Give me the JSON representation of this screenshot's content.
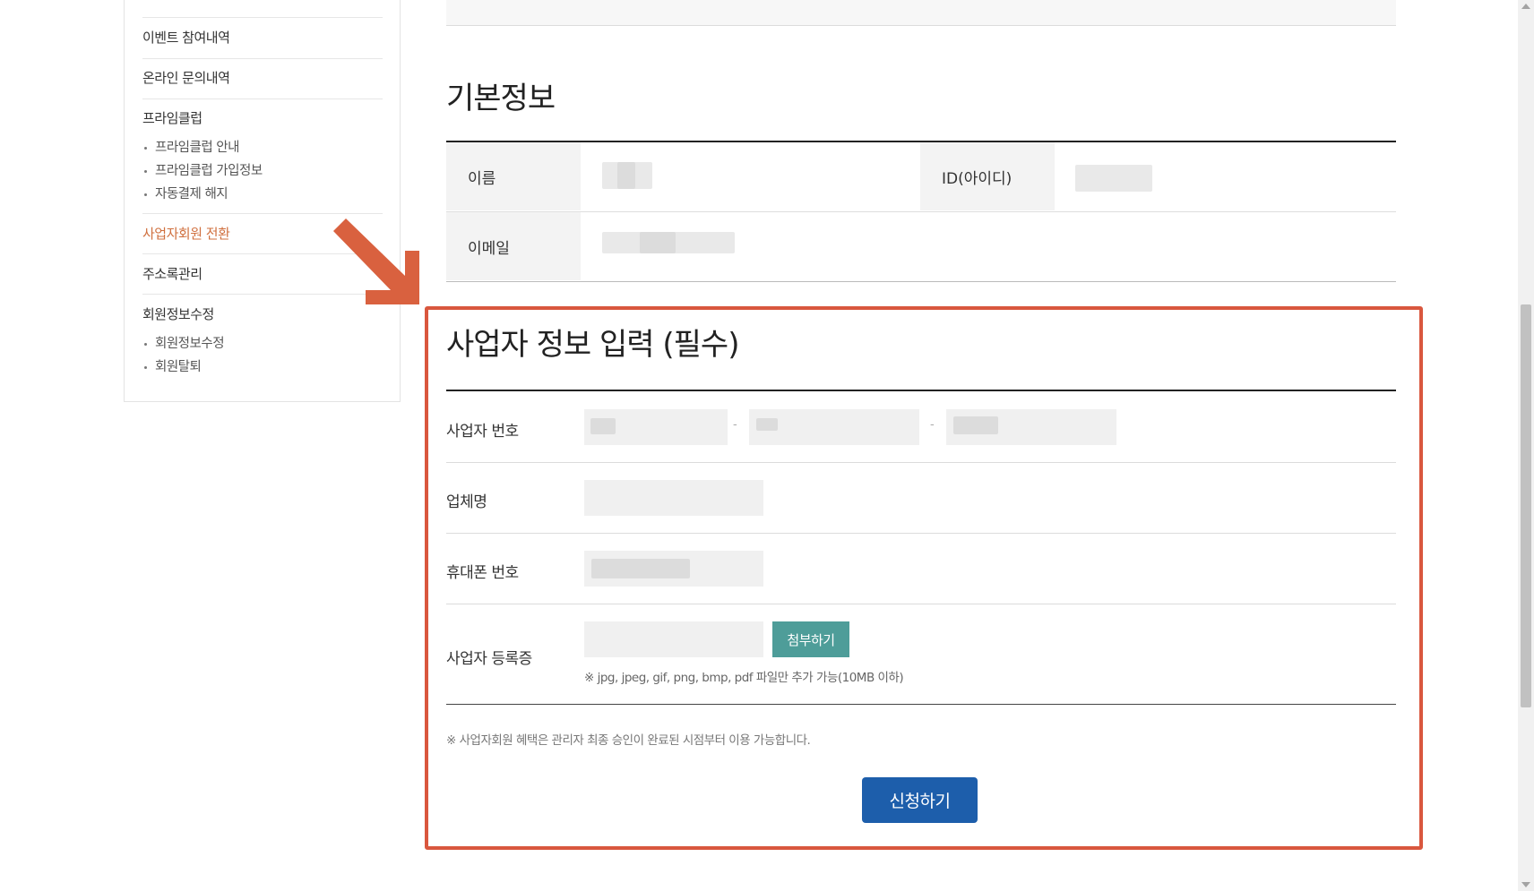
{
  "sidebar": {
    "items": [
      {
        "label": "이벤트 참여내역"
      },
      {
        "label": "온라인 문의내역"
      },
      {
        "label": "프라임클럽"
      },
      {
        "label": "사업자회원 전환"
      },
      {
        "label": "주소록관리"
      },
      {
        "label": "회원정보수정"
      }
    ],
    "prime_sub": [
      "프라임클럽 안내",
      "프라임클럽 가입정보",
      "자동결제 해지"
    ],
    "member_sub": [
      "회원정보수정",
      "회원탈퇴"
    ]
  },
  "basic_info": {
    "title": "기본정보",
    "name_label": "이름",
    "id_label": "ID(아이디)",
    "email_label": "이메일"
  },
  "business": {
    "title": "사업자 정보 입력 (필수)",
    "biz_number_label": "사업자 번호",
    "company_label": "업체명",
    "phone_label": "휴대폰 번호",
    "cert_label": "사업자 등록증",
    "attach_button": "첨부하기",
    "file_hint": "※ jpg, jpeg, gif, png, bmp, pdf 파일만 추가 가능(10MB 이하)",
    "notice": "※ 사업자회원 혜택은 관리자 최종 승인이 완료된 시점부터 이용 가능합니다.",
    "submit_button": "신청하기"
  },
  "colors": {
    "accent_orange": "#d0703f",
    "highlight_border": "#d9573e",
    "attach_button": "#4e9d99",
    "submit_button": "#1d5eab"
  }
}
